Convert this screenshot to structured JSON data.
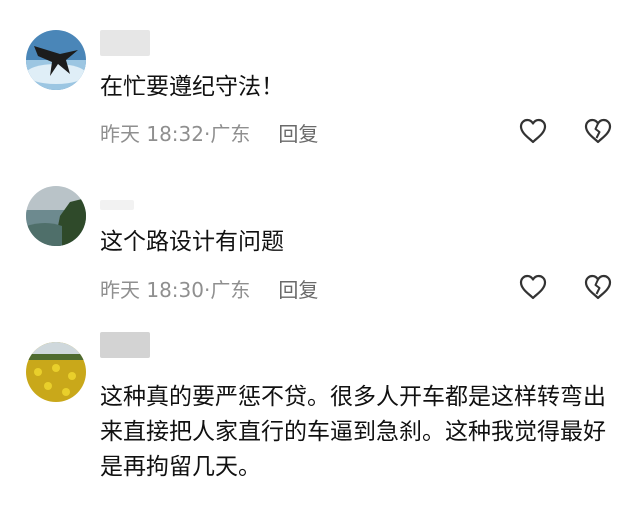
{
  "comments": [
    {
      "text": "在忙要遵纪守法！",
      "time": "昨天 18:32",
      "location": "广东",
      "reply_label": "回复"
    },
    {
      "text": "这个路设计有问题",
      "time": "昨天 18:30",
      "location": "广东",
      "reply_label": "回复"
    },
    {
      "text": "这种真的要严惩不贷。很多人开车都是这样转弯出来直接把人家直行的车逼到急刹。这种我觉得最好是再拘留几天。"
    }
  ],
  "icons": {
    "like": "heart-outline-icon",
    "dislike": "broken-heart-icon"
  },
  "colors": {
    "text": "#111111",
    "meta": "#8f8f8f",
    "icon": "#333333"
  }
}
